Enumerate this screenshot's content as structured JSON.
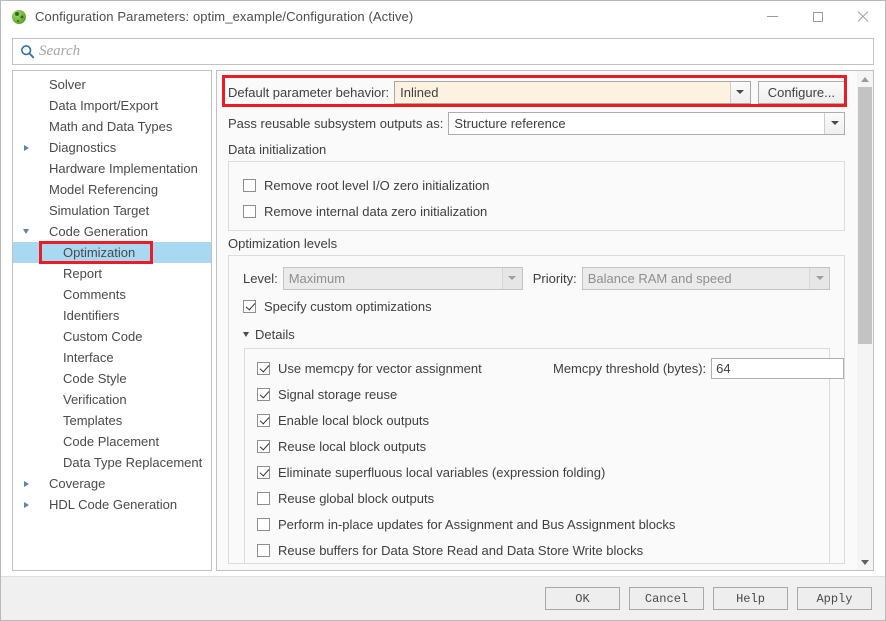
{
  "window": {
    "title": "Configuration Parameters: optim_example/Configuration (Active)",
    "app_icon": "simulink-green-icon",
    "minimize_icon": "minimize-icon",
    "maximize_icon": "maximize-icon",
    "close_icon": "close-icon"
  },
  "search": {
    "icon": "search-icon",
    "placeholder": "Search",
    "value": ""
  },
  "tree": {
    "items": [
      {
        "label": "Solver",
        "indent": 1,
        "toggle": "none",
        "selected": false
      },
      {
        "label": "Data Import/Export",
        "indent": 1,
        "toggle": "none",
        "selected": false
      },
      {
        "label": "Math and Data Types",
        "indent": 1,
        "toggle": "none",
        "selected": false
      },
      {
        "label": "Diagnostics",
        "indent": 0,
        "toggle": "collapsed",
        "selected": false
      },
      {
        "label": "Hardware Implementation",
        "indent": 1,
        "toggle": "none",
        "selected": false
      },
      {
        "label": "Model Referencing",
        "indent": 1,
        "toggle": "none",
        "selected": false
      },
      {
        "label": "Simulation Target",
        "indent": 1,
        "toggle": "none",
        "selected": false
      },
      {
        "label": "Code Generation",
        "indent": 0,
        "toggle": "expanded",
        "selected": false
      },
      {
        "label": "Optimization",
        "indent": 2,
        "toggle": "none",
        "selected": true
      },
      {
        "label": "Report",
        "indent": 2,
        "toggle": "none",
        "selected": false
      },
      {
        "label": "Comments",
        "indent": 2,
        "toggle": "none",
        "selected": false
      },
      {
        "label": "Identifiers",
        "indent": 2,
        "toggle": "none",
        "selected": false
      },
      {
        "label": "Custom Code",
        "indent": 2,
        "toggle": "none",
        "selected": false
      },
      {
        "label": "Interface",
        "indent": 2,
        "toggle": "none",
        "selected": false
      },
      {
        "label": "Code Style",
        "indent": 2,
        "toggle": "none",
        "selected": false
      },
      {
        "label": "Verification",
        "indent": 2,
        "toggle": "none",
        "selected": false
      },
      {
        "label": "Templates",
        "indent": 2,
        "toggle": "none",
        "selected": false
      },
      {
        "label": "Code Placement",
        "indent": 2,
        "toggle": "none",
        "selected": false
      },
      {
        "label": "Data Type Replacement",
        "indent": 2,
        "toggle": "none",
        "selected": false
      },
      {
        "label": "Coverage",
        "indent": 0,
        "toggle": "collapsed",
        "selected": false
      },
      {
        "label": "HDL Code Generation",
        "indent": 0,
        "toggle": "collapsed",
        "selected": false
      }
    ]
  },
  "panel": {
    "default_parameter_behavior": {
      "label": "Default parameter behavior:",
      "value": "Inlined",
      "configure_button": "Configure..."
    },
    "pass_reusable": {
      "label": "Pass reusable subsystem outputs as:",
      "value": "Structure reference"
    },
    "data_initialization": {
      "title": "Data initialization",
      "checkboxes": [
        {
          "label": "Remove root level I/O zero initialization",
          "checked": false
        },
        {
          "label": "Remove internal data zero initialization",
          "checked": false
        }
      ]
    },
    "optimization_levels": {
      "title": "Optimization levels",
      "level_label": "Level:",
      "level_value": "Maximum",
      "priority_label": "Priority:",
      "priority_value": "Balance RAM and speed",
      "specify_custom": {
        "label": "Specify custom optimizations",
        "checked": true
      },
      "details_label": "Details",
      "memcpy": {
        "checkbox_label": "Use memcpy for vector assignment",
        "checked": true,
        "threshold_label": "Memcpy threshold (bytes):",
        "threshold_value": "64"
      },
      "detail_checkboxes": [
        {
          "label": "Signal storage reuse",
          "checked": true
        },
        {
          "label": "Enable local block outputs",
          "checked": true
        },
        {
          "label": "Reuse local block outputs",
          "checked": true
        },
        {
          "label": "Eliminate superfluous local variables (expression folding)",
          "checked": true
        },
        {
          "label": "Reuse global block outputs",
          "checked": false
        },
        {
          "label": "Perform in-place updates for Assignment and Bus Assignment blocks",
          "checked": false
        },
        {
          "label": "Reuse buffers for Data Store Read and Data Store Write blocks",
          "checked": false
        }
      ]
    }
  },
  "scrollbar": {
    "up_icon": "scroll-up-icon",
    "down_icon": "scroll-down-icon",
    "thumb_fraction": 0.55
  },
  "footer": {
    "buttons": [
      {
        "label": "OK"
      },
      {
        "label": "Cancel"
      },
      {
        "label": "Help"
      },
      {
        "label": "Apply"
      }
    ]
  },
  "annotations": {
    "accent_color": "#ec1c24",
    "selection_color": "#a9d9f2",
    "modified_field_color": "#fdf2e0"
  }
}
